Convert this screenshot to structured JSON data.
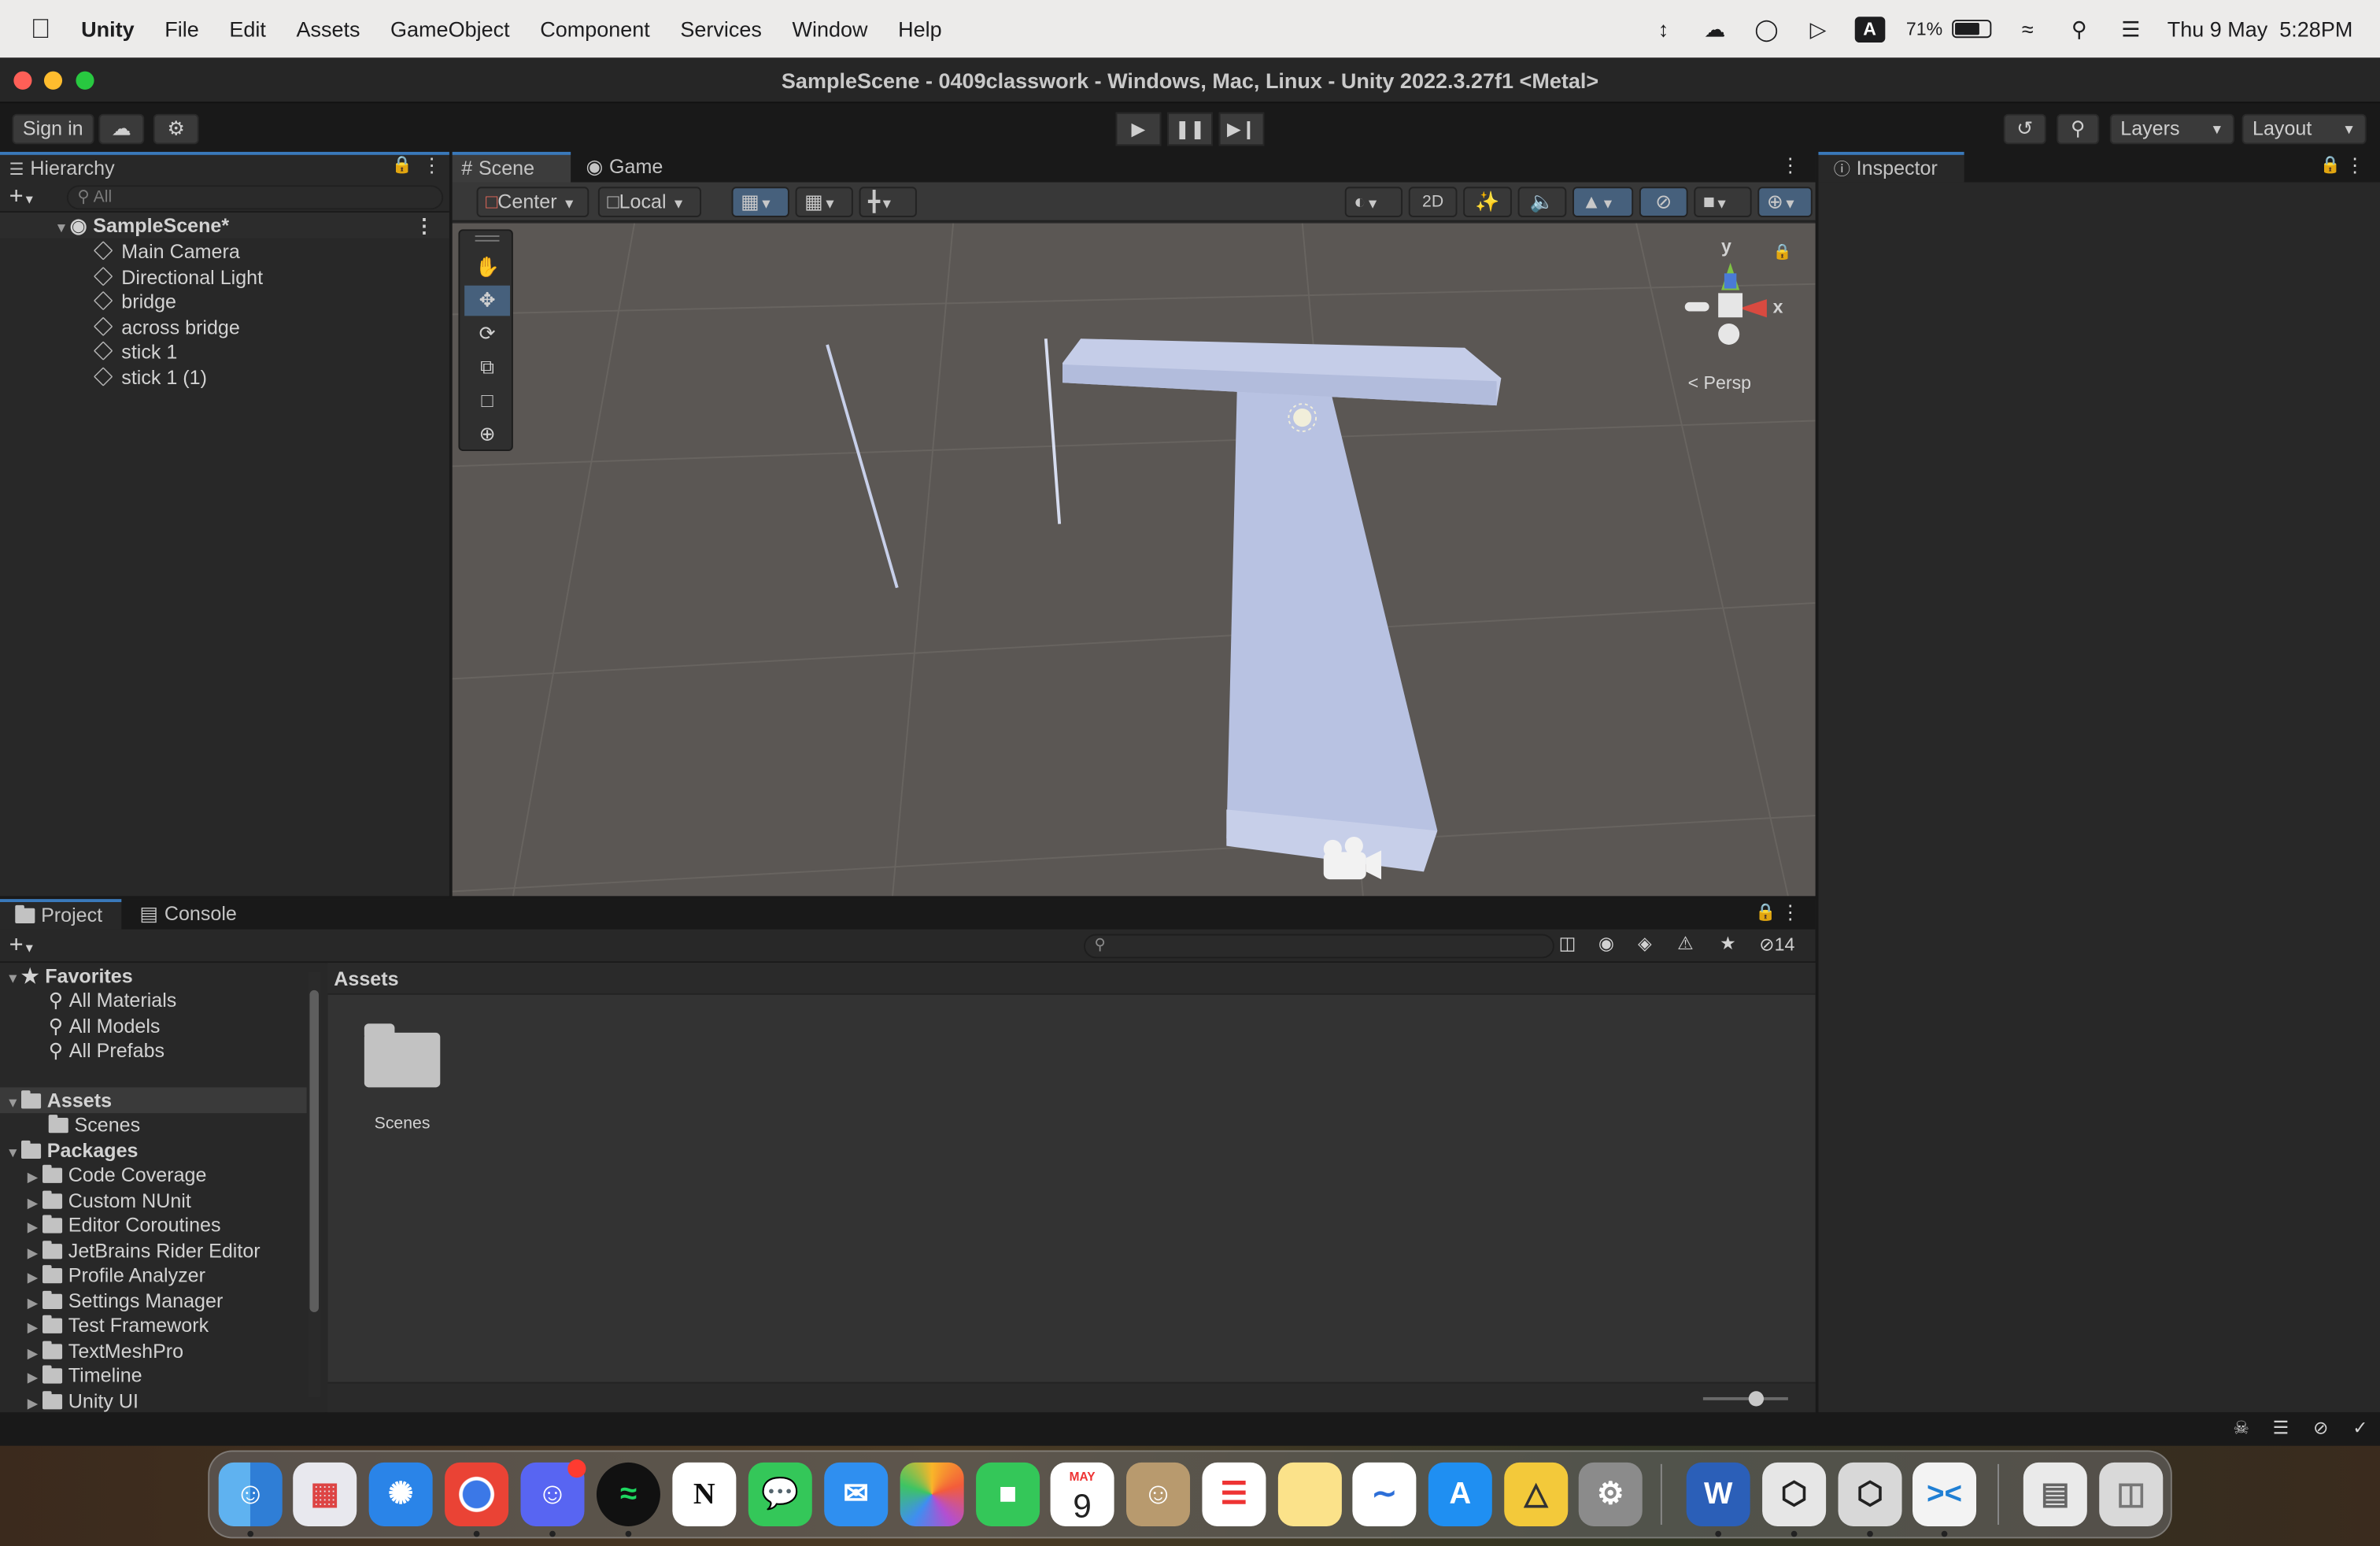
{
  "macos": {
    "app_name": "Unity",
    "menus": [
      "File",
      "Edit",
      "Assets",
      "GameObject",
      "Component",
      "Services",
      "Window",
      "Help"
    ],
    "battery": "71%",
    "input_source": "A",
    "datetime": "Thu 9 May  5:28PM"
  },
  "window": {
    "title": "SampleScene - 0409classwork - Windows, Mac, Linux - Unity 2022.3.27f1 <Metal>"
  },
  "toolbar": {
    "sign_in": "Sign in",
    "layers": "Layers",
    "layout": "Layout"
  },
  "hierarchy": {
    "tab": "Hierarchy",
    "search_placeholder": "All",
    "scene": "SampleScene*",
    "items": [
      "Main Camera",
      "Directional Light",
      "bridge",
      "across bridge",
      "stick 1",
      "stick 1 (1)"
    ]
  },
  "scene_view": {
    "tabs": [
      "Scene",
      "Game"
    ],
    "pivot": "Center",
    "space": "Local",
    "mode_2d": "2D",
    "gizmo": {
      "y": "y",
      "x": "x",
      "persp": "Persp"
    }
  },
  "inspector": {
    "tab": "Inspector"
  },
  "project": {
    "tabs": [
      "Project",
      "Console"
    ],
    "hidden_count": "14",
    "favorites_label": "Favorites",
    "favorites": [
      "All Materials",
      "All Models",
      "All Prefabs"
    ],
    "assets_label": "Assets",
    "asset_children": [
      "Scenes"
    ],
    "packages_label": "Packages",
    "packages": [
      "Code Coverage",
      "Custom NUnit",
      "Editor Coroutines",
      "JetBrains Rider Editor",
      "Profile Analyzer",
      "Settings Manager",
      "Test Framework",
      "TextMeshPro",
      "Timeline",
      "Unity UI"
    ],
    "breadcrumb": "Assets",
    "grid_items": [
      "Scenes"
    ]
  },
  "dock": {
    "calendar_month": "MAY",
    "calendar_day": "9",
    "apps": [
      "finder",
      "launchpad",
      "safari",
      "chrome",
      "discord",
      "spotify",
      "notion",
      "messages",
      "mail",
      "photos",
      "facetime",
      "calendar",
      "contacts",
      "reminders",
      "notes",
      "freeform",
      "app-store",
      "keynote",
      "system-settings",
      "word",
      "unity-hub",
      "unity",
      "vscode",
      "documents",
      "trash"
    ]
  },
  "colors": {
    "accent": "#3a79bb",
    "panel": "#282828",
    "scene_bg": "#5b5754",
    "object": "#b7c1e0"
  }
}
